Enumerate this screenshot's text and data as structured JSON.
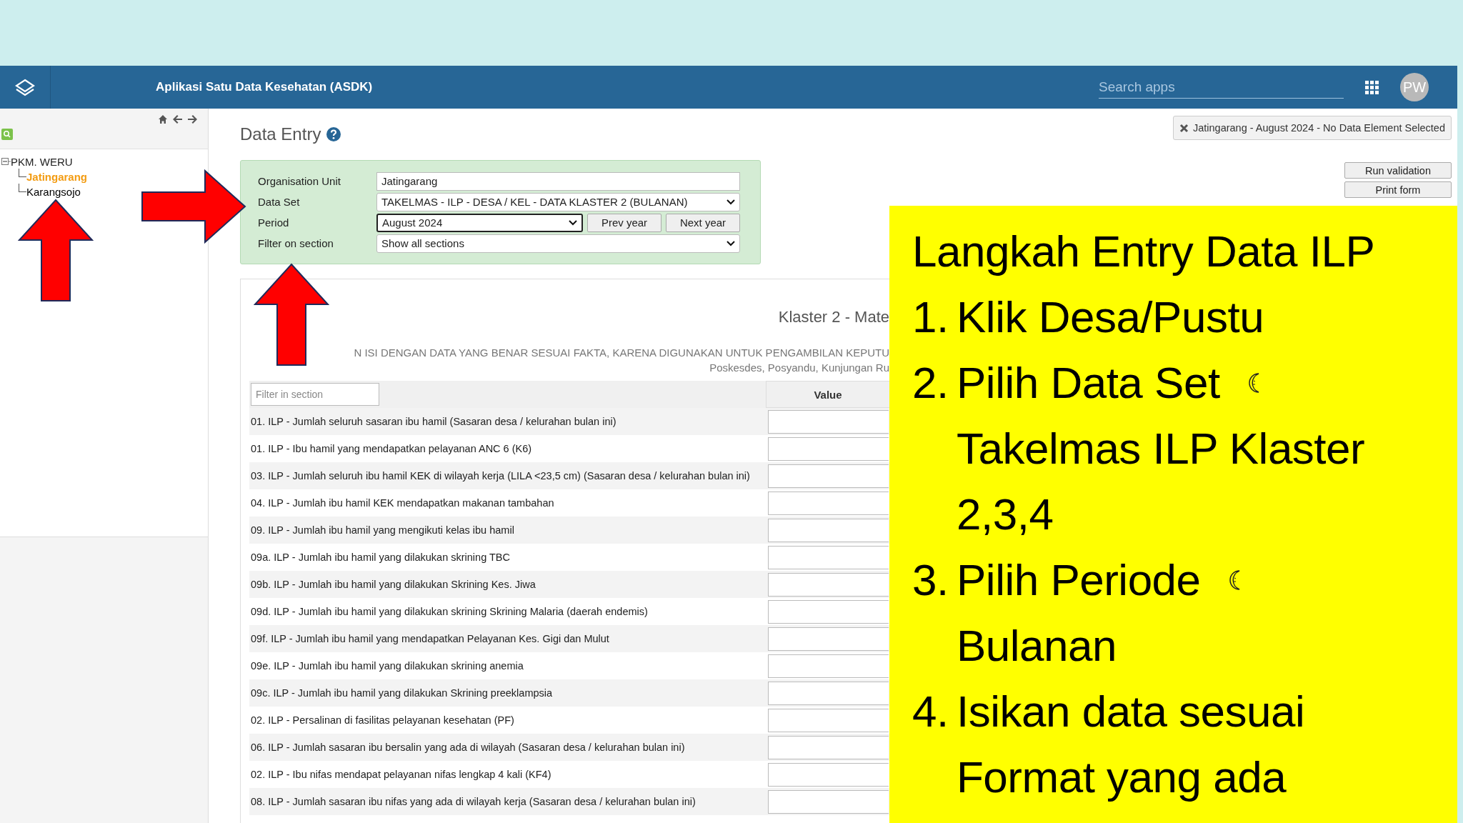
{
  "header": {
    "title": "Aplikasi Satu Data Kesehatan (ASDK)",
    "search": {
      "placeholder": "Search apps"
    },
    "avatar": "PW"
  },
  "sidebar": {
    "tree": [
      {
        "label": "PKM. WERU",
        "expanded": true,
        "selected": false,
        "children": [
          {
            "label": "Jatingarang",
            "selected": true
          },
          {
            "label": "Karangsojo",
            "selected": false
          }
        ]
      }
    ]
  },
  "page": {
    "title": "Data Entry"
  },
  "form": {
    "fields": [
      {
        "label": "Organisation Unit",
        "kind": "text",
        "value": "Jatingarang"
      },
      {
        "label": "Data Set",
        "kind": "select",
        "value": "TAKELMAS - ILP - DESA / KEL - DATA KLASTER 2 (BULANAN)"
      },
      {
        "label": "Period",
        "kind": "select",
        "value": "August 2024",
        "focused": true,
        "buttons": [
          "Prev year",
          "Next year"
        ]
      },
      {
        "label": "Filter on section",
        "kind": "select",
        "value": "Show all sections"
      }
    ]
  },
  "status_tag": "Jatingarang - August 2024 - No Data Element Selected",
  "actions": [
    "Run validation",
    "Print form"
  ],
  "section": {
    "title": "Klaster 2 - Mate",
    "notice": "N ISI DENGAN DATA YANG BENAR SESUAI FAKTA, KARENA DIGUNAKAN UNTUK PENGAMBILAN KEPUTU",
    "subnotice": "Poskesdes, Posyandu, Kunjungan Ru",
    "filter": {
      "placeholder": "Filter in section"
    },
    "value_header": "Value",
    "rows": [
      "01. ILP - Jumlah seluruh sasaran ibu hamil (Sasaran desa / kelurahan bulan ini)",
      "01. ILP - Ibu hamil yang mendapatkan pelayanan ANC 6 (K6)",
      "03. ILP - Jumlah seluruh ibu hamil KEK di wilayah kerja (LILA <23,5 cm) (Sasaran desa / kelurahan bulan ini)",
      "04. ILP - Jumlah ibu hamil KEK mendapatkan makanan tambahan",
      "09. ILP - Jumlah ibu hamil yang mengikuti kelas ibu hamil",
      "09a. ILP - Jumlah ibu hamil yang dilakukan skrining TBC",
      "09b. ILP - Jumlah ibu hamil yang dilakukan Skrining Kes. Jiwa",
      "09d. ILP - Jumlah ibu hamil yang dilakukan skrining Skrining Malaria (daerah endemis)",
      "09f. ILP - Jumlah ibu hamil yang mendapatkan Pelayanan Kes. Gigi dan Mulut",
      "09e. ILP - Jumlah ibu hamil yang dilakukan skrining anemia",
      "09c. ILP - Jumlah ibu hamil yang dilakukan Skrining preeklampsia",
      "02. ILP - Persalinan di fasilitas pelayanan kesehatan (PF)",
      "06. ILP - Jumlah sasaran ibu bersalin yang ada di wilayah (Sasaran desa / kelurahan bulan ini)",
      "02. ILP - Ibu nifas mendapat pelayanan nifas lengkap 4 kali (KF4)",
      "08. ILP - Jumlah sasaran ibu nifas yang ada di wilayah kerja (Sasaran desa / kelurahan bulan ini)"
    ]
  },
  "callout": {
    "title": "Langkah Entry Data ILP",
    "steps": [
      {
        "number": "1.",
        "lines": [
          "Klik Desa/Pustu"
        ],
        "moon": false
      },
      {
        "number": "2.",
        "lines": [
          "Pilih Data Set",
          "Takelmas ILP Klaster",
          "2,3,4"
        ],
        "moon": true
      },
      {
        "number": "3.",
        "lines": [
          "Pilih Periode",
          "Bulanan"
        ],
        "moon": true
      },
      {
        "number": "4.",
        "lines": [
          "Isikan data sesuai",
          "Format yang ada"
        ],
        "moon": false
      }
    ]
  }
}
